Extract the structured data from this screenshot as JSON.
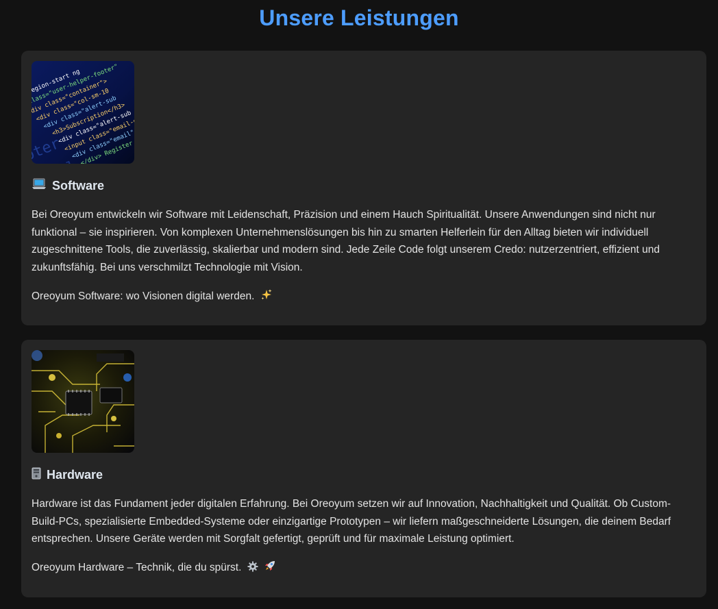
{
  "header": {
    "title": "Unsere Leistungen"
  },
  "services": [
    {
      "icon": "laptop-icon",
      "title": "Software",
      "image": "code-screen-image",
      "description": "Bei Oreoyum entwickeln wir Software mit Leidenschaft, Präzision und einem Hauch Spiritualität. Unsere Anwendungen sind nicht nur funktional – sie inspirieren. Von komplexen Unternehmenslösungen bis hin zu smarten Helferlein für den Alltag bieten wir individuell zugeschnittene Tools, die zuverlässig, skalierbar und modern sind. Jede Zeile Code folgt unserem Credo: nutzerzentriert, effizient und zukunftsfähig. Bei uns verschmilzt Technologie mit Vision.",
      "tagline": "Oreoyum Software: wo Visionen digital werden.",
      "tagline_icons": [
        "sparkles-icon"
      ]
    },
    {
      "icon": "computer-tower-icon",
      "title": "Hardware",
      "image": "circuit-board-image",
      "description": "Hardware ist das Fundament jeder digitalen Erfahrung. Bei Oreoyum setzen wir auf Innovation, Nachhaltigkeit und Qualität. Ob Custom-Build-PCs, spezialisierte Embedded-Systeme oder einzigartige Prototypen – wir liefern maßgeschneiderte Lösungen, die deinem Bedarf entsprechen. Unsere Geräte werden mit Sorgfalt gefertigt, geprüft und für maximale Leistung optimiert.",
      "tagline": "Oreoyum Hardware – Technik, die du spürst.",
      "tagline_icons": [
        "gear-icon",
        "rocket-icon"
      ]
    }
  ],
  "colors": {
    "background": "#121212",
    "card": "#252525",
    "accent": "#4d9dff",
    "text": "#e3e3e3"
  }
}
